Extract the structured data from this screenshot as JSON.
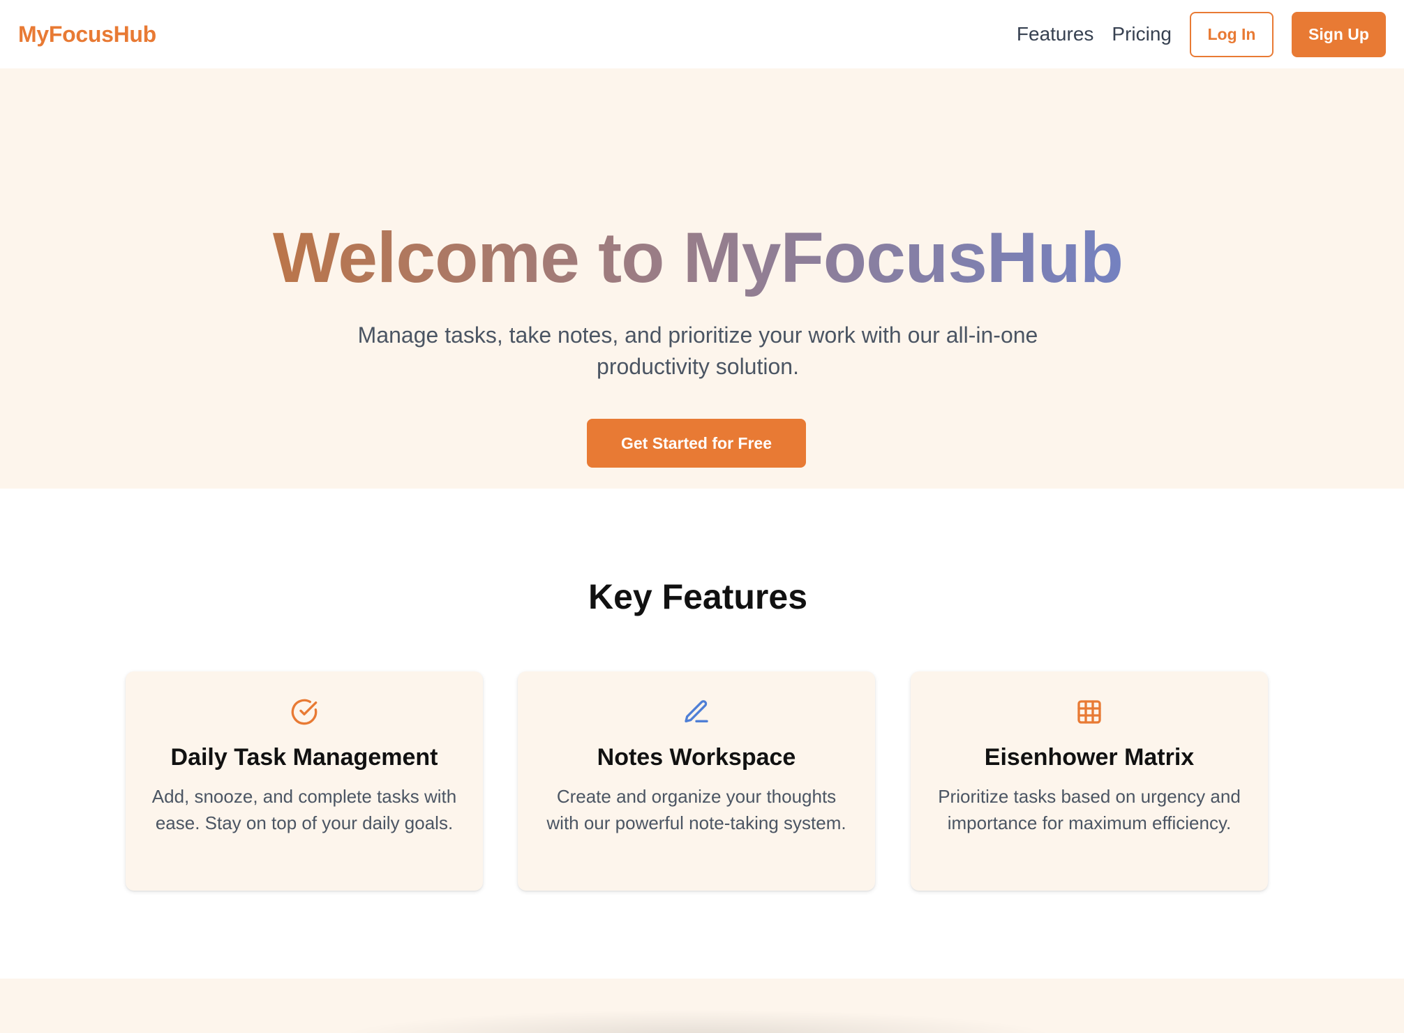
{
  "header": {
    "logo": "MyFocusHub",
    "nav": {
      "features": "Features",
      "pricing": "Pricing"
    },
    "login_label": "Log In",
    "signup_label": "Sign Up"
  },
  "hero": {
    "title": "Welcome to MyFocusHub",
    "subtitle": "Manage tasks, take notes, and prioritize your work with our all-in-one productivity solution.",
    "cta_label": "Get Started for Free"
  },
  "features": {
    "title": "Key Features",
    "cards": [
      {
        "icon": "check-circle-icon",
        "icon_color": "#e87a34",
        "title": "Daily Task Management",
        "description": "Add, snooze, and complete tasks with ease. Stay on top of your daily goals."
      },
      {
        "icon": "pencil-icon",
        "icon_color": "#4f7fd6",
        "title": "Notes Workspace",
        "description": "Create and organize your thoughts with our powerful note-taking system."
      },
      {
        "icon": "grid-icon",
        "icon_color": "#e87a34",
        "title": "Eisenhower Matrix",
        "description": "Prioritize tasks based on urgency and importance for maximum efficiency."
      }
    ]
  },
  "colors": {
    "accent": "#e87a34",
    "hero_background": "#fdf5ec",
    "text_muted": "#4b5563"
  }
}
